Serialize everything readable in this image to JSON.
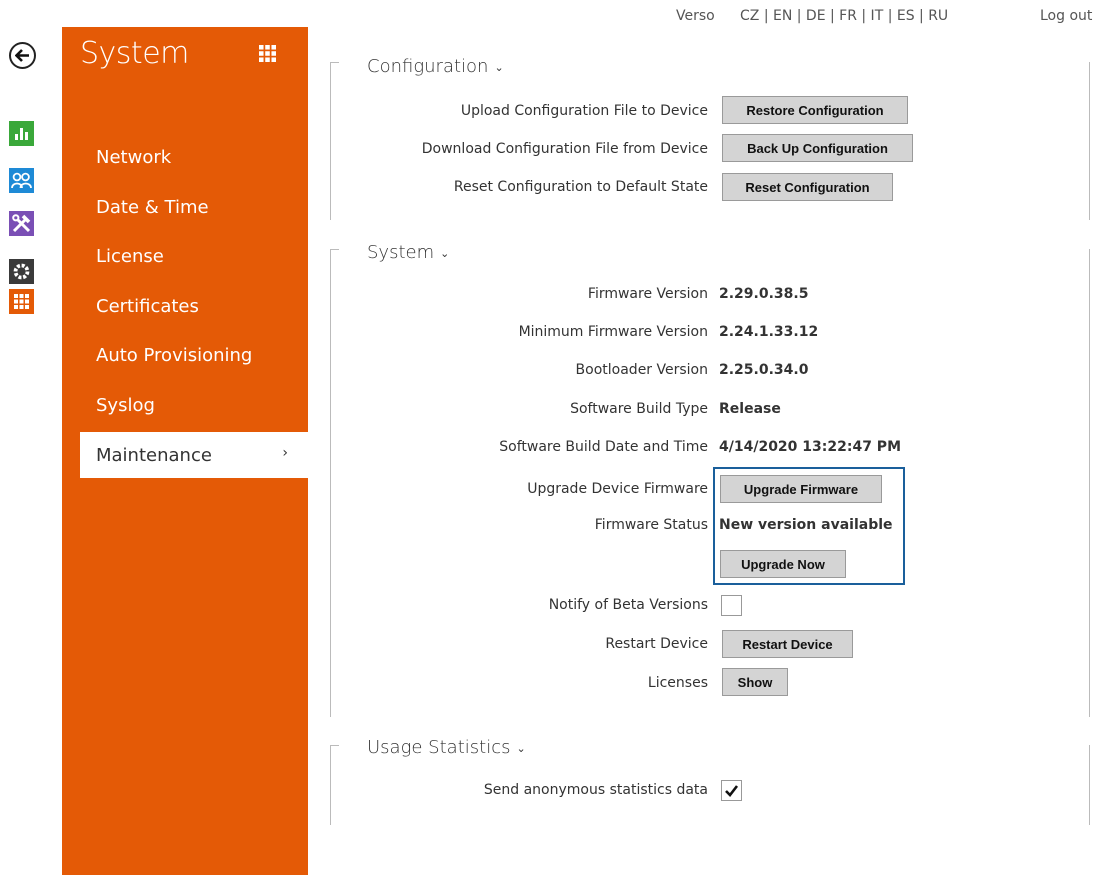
{
  "topbar": {
    "verso": "Verso",
    "languages": "CZ | EN | DE | FR | IT | ES | RU",
    "logout": "Log out"
  },
  "rail": {
    "icons": [
      "back-arrow-icon",
      "status-chart-icon",
      "directory-people-icon",
      "hardware-tools-icon",
      "services-gear-icon",
      "system-grid-icon"
    ]
  },
  "sidenav": {
    "title": "System",
    "items": [
      "Network",
      "Date & Time",
      "License",
      "Certificates",
      "Auto Provisioning",
      "Syslog",
      "Maintenance"
    ],
    "active_chevron": "›"
  },
  "configuration": {
    "title": "Configuration",
    "rows": [
      {
        "label": "Upload Configuration File to Device",
        "button": "Restore Configuration"
      },
      {
        "label": "Download Configuration File from Device",
        "button": "Back Up Configuration"
      },
      {
        "label": "Reset Configuration to Default State",
        "button": "Reset Configuration"
      }
    ]
  },
  "system": {
    "title": "System",
    "firmware_version_label": "Firmware Version",
    "firmware_version": "2.29.0.38.5",
    "min_firmware_label": "Minimum Firmware Version",
    "min_firmware": "2.24.1.33.12",
    "bootloader_label": "Bootloader Version",
    "bootloader": "2.25.0.34.0",
    "build_type_label": "Software Build Type",
    "build_type": "Release",
    "build_date_label": "Software Build Date and Time",
    "build_date": "4/14/2020 13:22:47 PM",
    "upgrade_label": "Upgrade Device Firmware",
    "upgrade_button": "Upgrade Firmware",
    "status_label": "Firmware Status",
    "status_value": "New version available",
    "upgrade_now_button": "Upgrade Now",
    "notify_beta_label": "Notify of Beta Versions",
    "notify_beta_checked": false,
    "restart_label": "Restart Device",
    "restart_button": "Restart Device",
    "licenses_label": "Licenses",
    "licenses_button": "Show"
  },
  "usage": {
    "title": "Usage Statistics",
    "send_label": "Send anonymous statistics data",
    "send_checked": true
  },
  "colors": {
    "accent": "#e45a06",
    "highlight_border": "#1a5f9b"
  }
}
